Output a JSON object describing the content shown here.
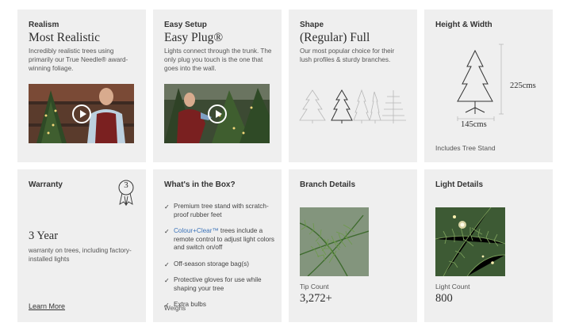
{
  "cards": {
    "realism": {
      "eyebrow": "Realism",
      "title": "Most Realistic",
      "desc": "Incredibly realistic trees using primarily our True Needle® award-winning foliage."
    },
    "setup": {
      "eyebrow": "Easy Setup",
      "title": "Easy Plug®",
      "desc": "Lights connect through the trunk. The only plug you touch is the one that goes into the wall."
    },
    "shape": {
      "eyebrow": "Shape",
      "title": "(Regular) Full",
      "desc": "Our most popular choice for their lush profiles & sturdy branches."
    },
    "dimensions": {
      "eyebrow": "Height & Width",
      "height": "225cms",
      "width": "145cms",
      "note": "Includes Tree Stand"
    },
    "warranty": {
      "eyebrow": "Warranty",
      "badge_number": "3",
      "value": "3 Year",
      "desc": "warranty on trees, including factory-installed lights",
      "link": "Learn More"
    },
    "box": {
      "eyebrow": "What's in the Box?",
      "items": [
        {
          "text": "Premium tree stand with scratch-proof rubber feet"
        },
        {
          "highlight": "Colour+Clear™",
          "text": " trees include a remote control to adjust light colors and switch on/off"
        },
        {
          "text": "Off-season storage bag(s)"
        },
        {
          "text": "Protective gloves for use while shaping your tree"
        },
        {
          "text": "Extra bulbs"
        }
      ],
      "tail": "Weighs"
    },
    "branch": {
      "eyebrow": "Branch Details",
      "label": "Tip Count",
      "value": "3,272+"
    },
    "light": {
      "eyebrow": "Light Details",
      "label": "Light Count",
      "value": "800"
    }
  },
  "colors": {
    "card_bg": "#efefef",
    "link_blue": "#3b73b9",
    "text_dark": "#2c2c2c"
  }
}
